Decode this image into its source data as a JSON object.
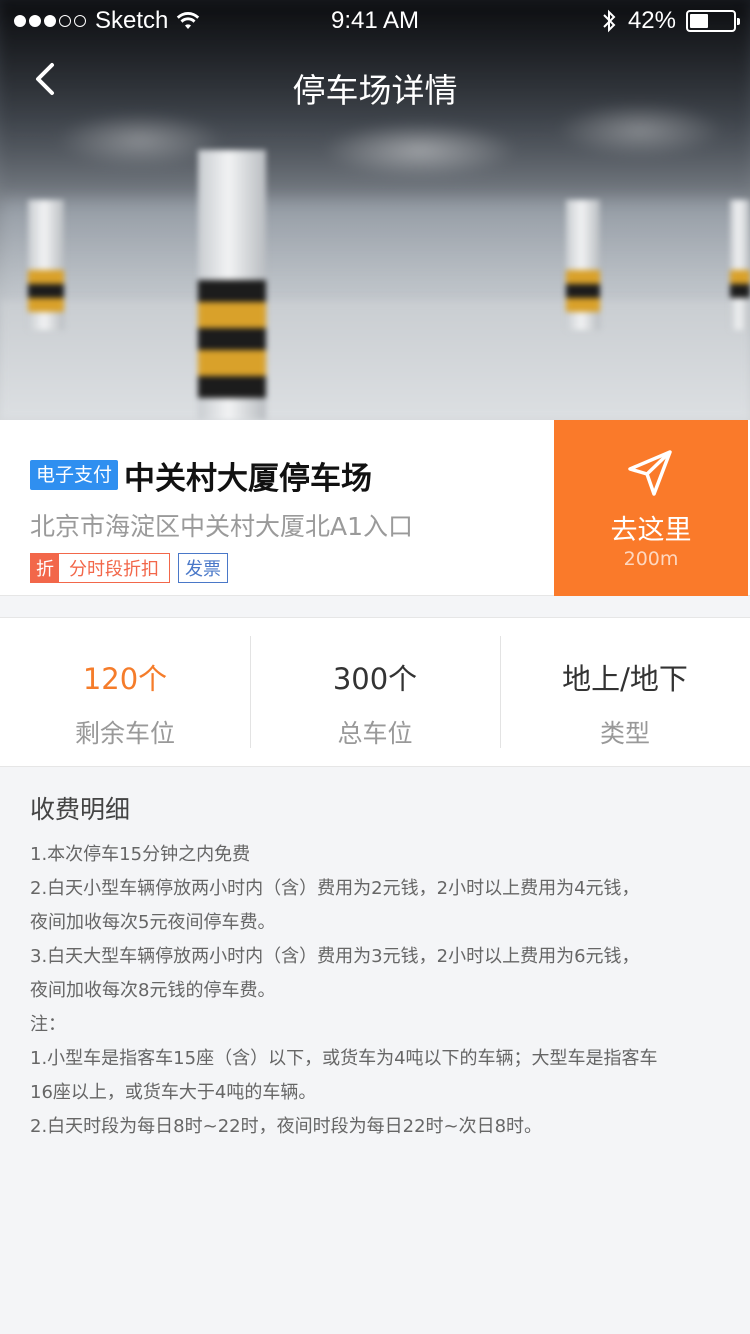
{
  "status_bar": {
    "carrier": "Sketch",
    "time": "9:41 AM",
    "battery": "42%",
    "battery_level": 0.42,
    "signal_bars_filled": 3,
    "signal_bars_total": 5
  },
  "nav": {
    "title": "停车场详情",
    "back_icon": "chevron-left-icon"
  },
  "parking": {
    "pay_tag": "电子支付",
    "name": "中关村大厦停车场",
    "address": "北京市海淀区中关村大厦北A1入口",
    "discount_icon": "折",
    "discount_text": "分时段折扣",
    "invoice_tag": "发票"
  },
  "navigate": {
    "label": "去这里",
    "distance": "200m",
    "icon": "navigate-arrow-icon",
    "color": "#fa7a2a"
  },
  "stats": [
    {
      "value": "120个",
      "label": "剩余车位"
    },
    {
      "value": "300个",
      "label": "总车位"
    },
    {
      "value": "地上/地下",
      "label": "类型"
    }
  ],
  "fee": {
    "title": "收费明细",
    "lines": [
      "1.本次停车15分钟之内免费",
      "2.白天小型车辆停放两小时内（含）费用为2元钱，2小时以上费用为4元钱，",
      "夜间加收每次5元夜间停车费。",
      "3.白天大型车辆停放两小时内（含）费用为3元钱，2小时以上费用为6元钱，",
      "夜间加收每次8元钱的停车费。",
      "注：",
      "1.小型车是指客车15座（含）以下，或货车为4吨以下的车辆；大型车是指客车",
      "16座以上，或货车大于4吨的车辆。",
      "2.白天时段为每日8时~22时，夜间时段为每日22时~次日8时。"
    ]
  }
}
